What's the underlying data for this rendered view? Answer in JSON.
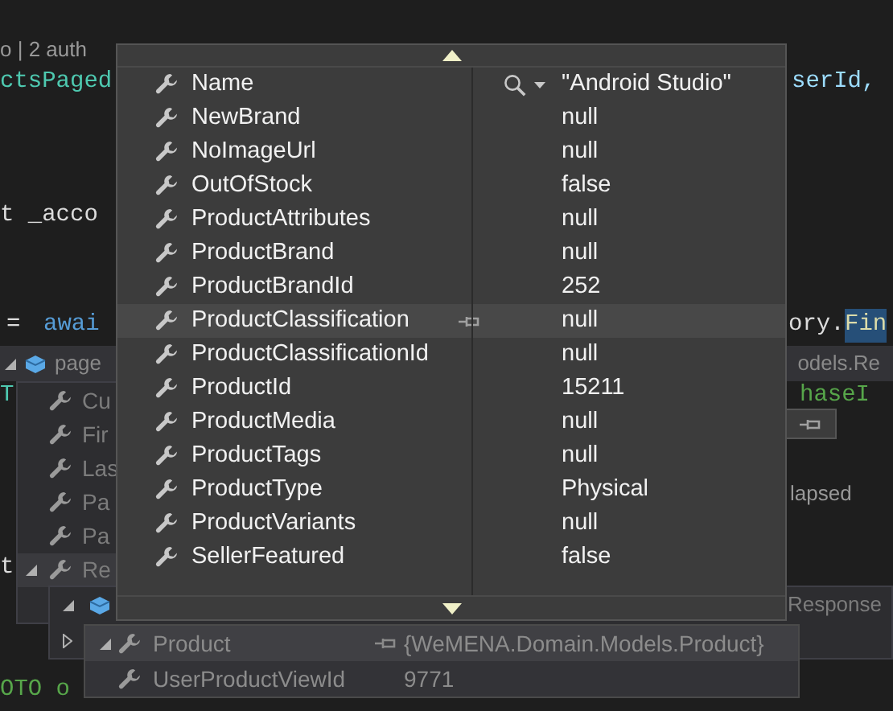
{
  "editor": {
    "fragments": [
      {
        "kind": "codelens",
        "text": "o | 2 auth"
      },
      {
        "kind": "type",
        "text": "ctsPaged"
      },
      {
        "kind": "variable",
        "text": "serId,"
      },
      {
        "kind": "plain",
        "text": "t _acco"
      },
      {
        "kind": "plain",
        "text": "="
      },
      {
        "kind": "keyword",
        "text": "awai"
      },
      {
        "kind": "plain",
        "text": "ory."
      },
      {
        "kind": "selected",
        "text": "Fin"
      },
      {
        "kind": "type",
        "text": "T"
      },
      {
        "kind": "comment",
        "text": "haseI"
      },
      {
        "kind": "codelens",
        "text": "lapsed"
      },
      {
        "kind": "plain",
        "text": "t"
      },
      {
        "kind": "comment",
        "text": "OTO o"
      }
    ]
  },
  "back_datatip": {
    "header": {
      "name": "page",
      "value": "odels.Re",
      "expanded": true
    },
    "rows": [
      {
        "name": "Cu",
        "selected": false,
        "expanded": false
      },
      {
        "name": "Fir",
        "selected": false,
        "expanded": false
      },
      {
        "name": "Las",
        "selected": false,
        "expanded": false
      },
      {
        "name": "Pa",
        "selected": false,
        "expanded": false
      },
      {
        "name": "Pa",
        "selected": false,
        "expanded": false
      },
      {
        "name": "Re",
        "selected": true,
        "expanded": true
      }
    ]
  },
  "nested_datatip": {
    "rows": [
      {
        "value": "Response",
        "expanded": true
      },
      {
        "expanded": false
      }
    ]
  },
  "inner_datatip": {
    "rows": [
      {
        "name": "Product",
        "value": "{WeMENA.Domain.Models.Product}",
        "expanded": true,
        "selected": true
      },
      {
        "name": "UserProductViewId",
        "value": "9771",
        "expanded": false,
        "selected": false
      }
    ]
  },
  "datatip": {
    "rows": [
      {
        "name": "Name",
        "value": "\"Android Studio\"",
        "visualizer": true,
        "selected": false
      },
      {
        "name": "NewBrand",
        "value": "null",
        "visualizer": false,
        "selected": false
      },
      {
        "name": "NoImageUrl",
        "value": "null",
        "visualizer": false,
        "selected": false
      },
      {
        "name": "OutOfStock",
        "value": "false",
        "visualizer": false,
        "selected": false
      },
      {
        "name": "ProductAttributes",
        "value": "null",
        "visualizer": false,
        "selected": false
      },
      {
        "name": "ProductBrand",
        "value": "null",
        "visualizer": false,
        "selected": false
      },
      {
        "name": "ProductBrandId",
        "value": "252",
        "visualizer": false,
        "selected": false
      },
      {
        "name": "ProductClassification",
        "value": "null",
        "visualizer": false,
        "selected": true
      },
      {
        "name": "ProductClassificationId",
        "value": "null",
        "visualizer": false,
        "selected": false
      },
      {
        "name": "ProductId",
        "value": "15211",
        "visualizer": false,
        "selected": false
      },
      {
        "name": "ProductMedia",
        "value": "null",
        "visualizer": false,
        "selected": false
      },
      {
        "name": "ProductTags",
        "value": "null",
        "visualizer": false,
        "selected": false
      },
      {
        "name": "ProductType",
        "value": "Physical",
        "visualizer": false,
        "selected": false
      },
      {
        "name": "ProductVariants",
        "value": "null",
        "visualizer": false,
        "selected": false
      },
      {
        "name": "SellerFeatured",
        "value": "false",
        "visualizer": false,
        "selected": false
      }
    ]
  }
}
